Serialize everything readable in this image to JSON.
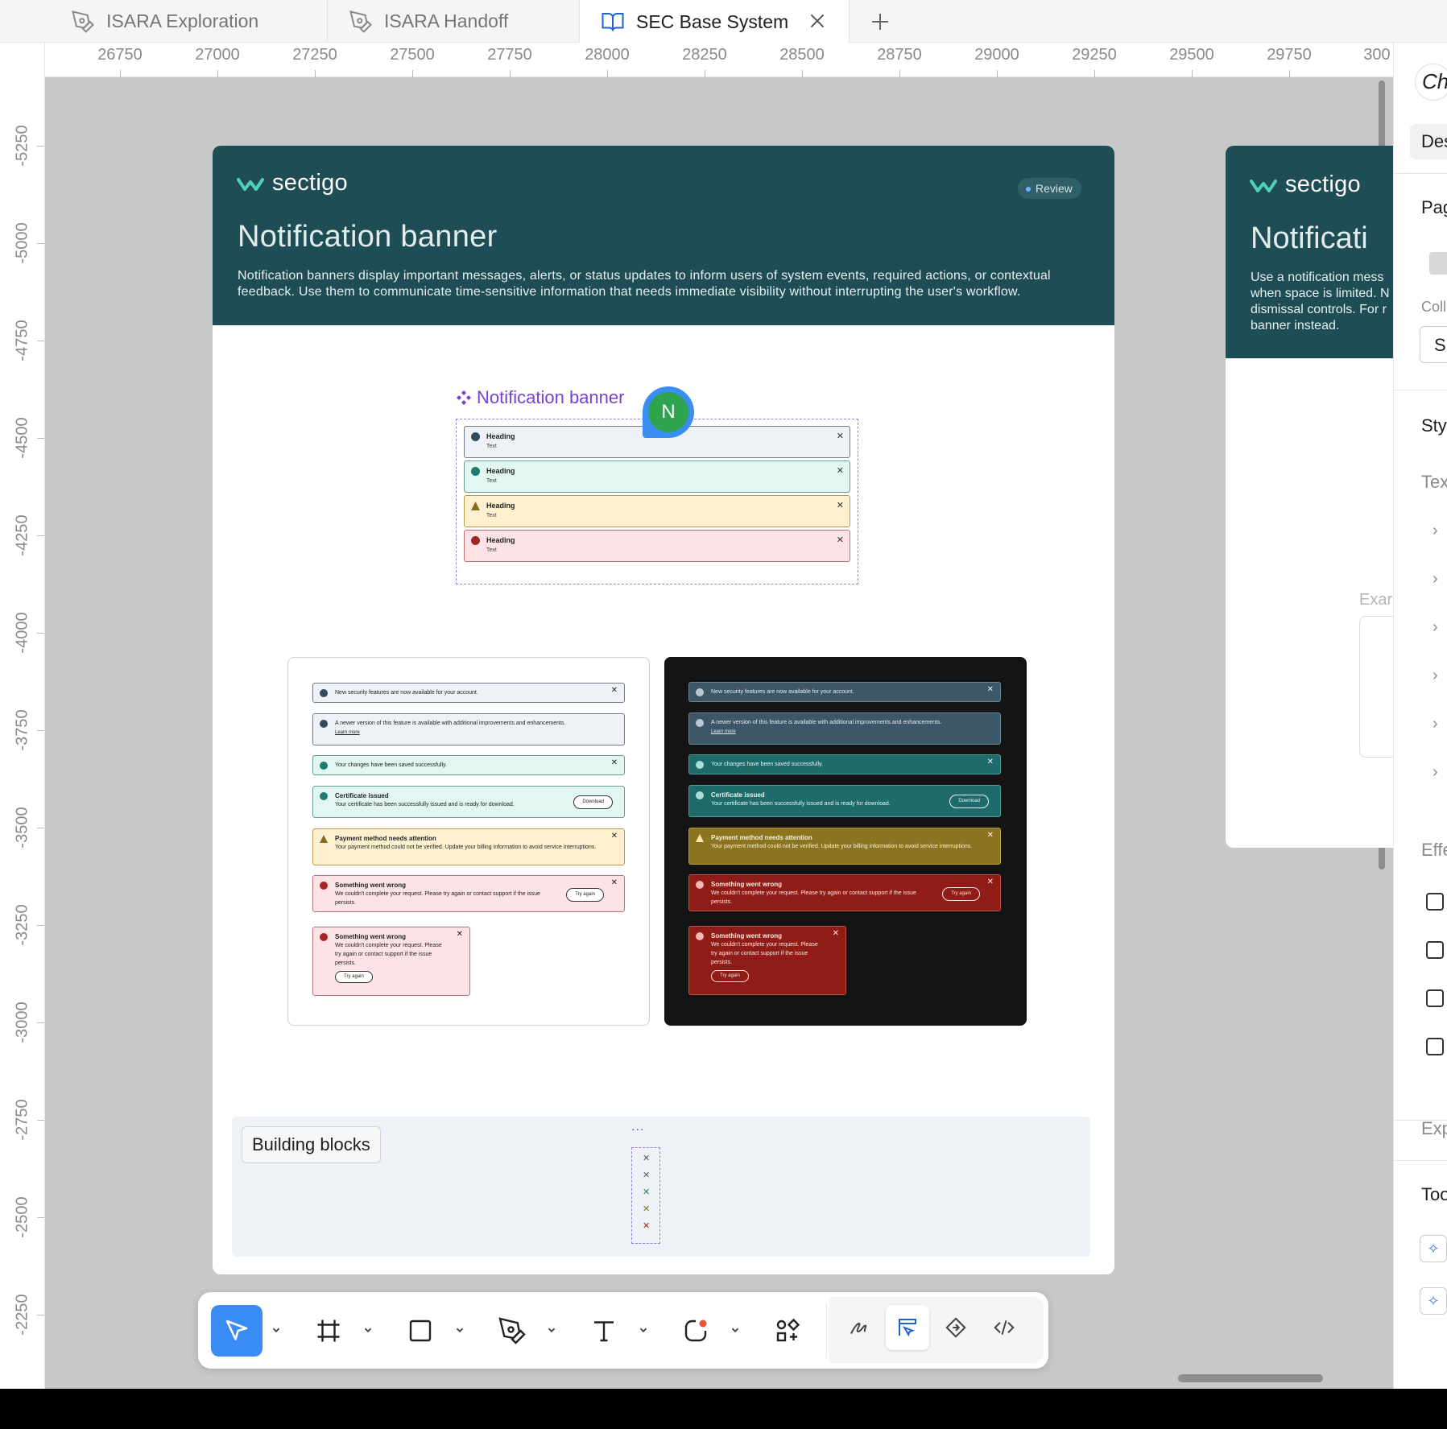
{
  "tabs": [
    {
      "label": "ISARA Exploration",
      "icon": "pen-tool-icon",
      "active": false
    },
    {
      "label": "ISARA Handoff",
      "icon": "pen-tool-icon",
      "active": false
    },
    {
      "label": "SEC Base System",
      "icon": "book-open-icon",
      "active": true
    }
  ],
  "ruler": {
    "top": [
      "26750",
      "27000",
      "27250",
      "27500",
      "27750",
      "28000",
      "28250",
      "28500",
      "28750",
      "29000",
      "29250",
      "29500",
      "29750",
      "300"
    ],
    "left": [
      "-5250",
      "-5000",
      "-4750",
      "-4500",
      "-4250",
      "-4000",
      "-3750",
      "-3500",
      "-3250",
      "-3000",
      "-2750",
      "-2500",
      "-2250"
    ]
  },
  "frame": {
    "brand": "sectigo",
    "badge": "Review",
    "title": "Notification banner",
    "description": "Notification banners display important messages, alerts, or status updates to inform users of system events, required actions, or contextual feedback. Use them to communicate time-sensitive information that needs immediate visibility without interrupting the user's workflow."
  },
  "component": {
    "name": "Notification banner",
    "variants": [
      {
        "heading": "Heading",
        "text": "Text",
        "kind": "info"
      },
      {
        "heading": "Heading",
        "text": "Text",
        "kind": "success"
      },
      {
        "heading": "Heading",
        "text": "Text",
        "kind": "warning"
      },
      {
        "heading": "Heading",
        "text": "Text",
        "kind": "error"
      }
    ]
  },
  "avatar": {
    "initial": "N"
  },
  "examples": {
    "info_1": "New security features are now available for your account.",
    "info_2": "A newer version of this feature is available with additional improvements and enhancements.",
    "learn_more": "Learn more",
    "success_1": "Your changes have been saved successfully.",
    "cert_title": "Certificate issued",
    "cert_text": "Your certificate has been successfully issued and is ready for download.",
    "download": "Download",
    "pay_title": "Payment method needs attention",
    "pay_text": "Your payment method could not be verified. Update your billing information to avoid service interruptions.",
    "err_title": "Something went wrong",
    "err_text": "We couldn't complete your request. Please try again or contact support if the issue persists.",
    "try_again": "Try again"
  },
  "building_blocks": {
    "label": "Building blocks",
    "dots": "..."
  },
  "frame2": {
    "brand": "sectigo",
    "title": "Notificati",
    "desc_lines": [
      "Use a notification mess",
      "when space is limited. N",
      "dismissal controls. For r",
      "banner instead."
    ],
    "example_label": "Exar"
  },
  "right_panel": {
    "des": "Des",
    "page": "Pag",
    "coll": "Coll",
    "s": "S",
    "style": "Sty",
    "text": "Tex",
    "effects": "Effe",
    "export": "Exp",
    "tools": "Too"
  },
  "colors": {
    "header": "#1e4d56",
    "accent": "#3b8bf5",
    "component_purple": "#7b3fd1",
    "info_bg": "#eef2f6",
    "success_bg": "#e2f6f2",
    "warning_bg": "#fdf1cf",
    "error_bg": "#fde3e5"
  },
  "toolbar": {
    "tools": [
      "move-icon",
      "frame-icon",
      "rectangle-icon",
      "pen-icon",
      "text-icon",
      "shape-icon",
      "components-icon"
    ],
    "modes": [
      "draw-icon",
      "design-icon",
      "prototype-icon",
      "code-icon"
    ]
  }
}
